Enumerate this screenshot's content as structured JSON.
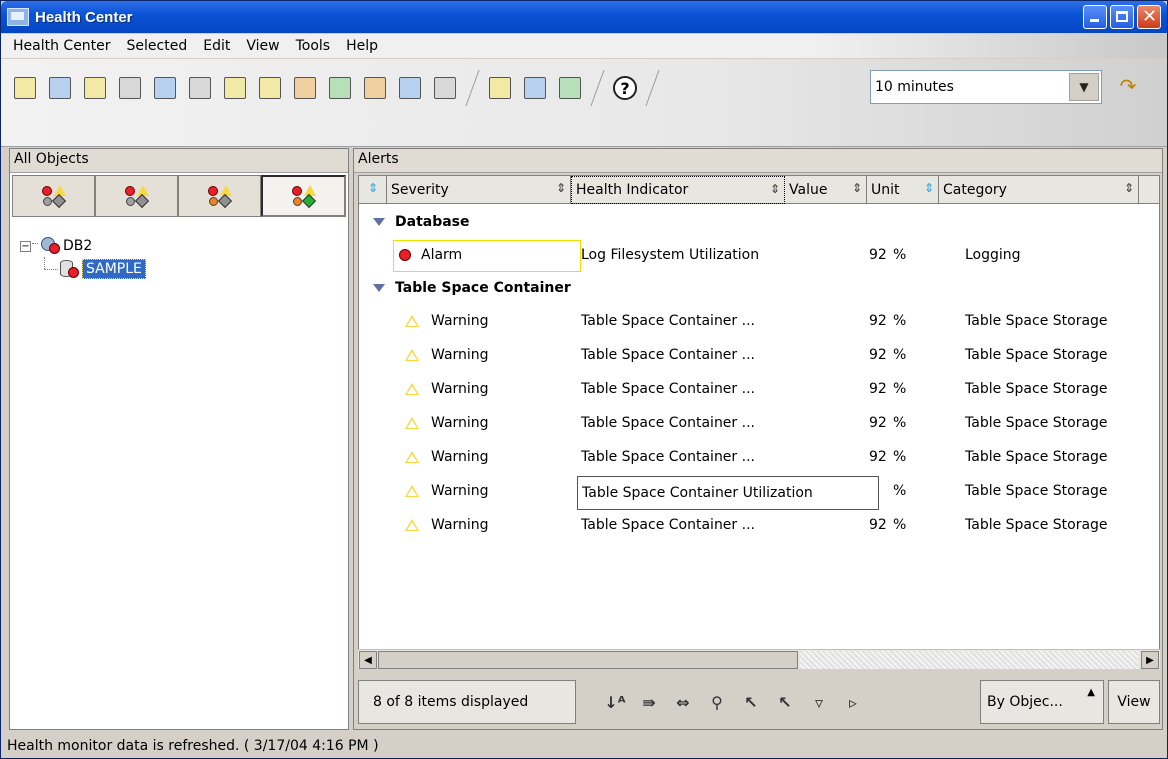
{
  "window": {
    "title": "Health Center"
  },
  "menu": [
    "Health Center",
    "Selected",
    "Edit",
    "View",
    "Tools",
    "Help"
  ],
  "toolbar": {
    "icons": [
      "object-tree-icon",
      "objects-icon",
      "hierarchy-icon",
      "database-icon",
      "command-icon",
      "script-icon",
      "journal-icon",
      "notes-icon",
      "license-icon",
      "health-icon",
      "replication-icon",
      "satellite-icon",
      "storage-icon",
      "task-icon",
      "console-icon",
      "list-icon"
    ],
    "refresh_interval": "10 minutes",
    "help_label": "?"
  },
  "left_panel": {
    "title": "All Objects",
    "filters": [
      {
        "name": "filter-alarm",
        "active": false
      },
      {
        "name": "filter-warning",
        "active": false
      },
      {
        "name": "filter-attention",
        "active": false
      },
      {
        "name": "filter-all",
        "active": true
      }
    ],
    "tree": {
      "root_label": "DB2",
      "child_label": "SAMPLE"
    }
  },
  "alerts_panel": {
    "title": "Alerts",
    "columns": [
      "Severity",
      "Health Indicator",
      "Value",
      "Unit",
      "Category"
    ],
    "groups": [
      {
        "label": "Database",
        "rows": [
          {
            "severity": "Alarm",
            "indicator": "Log Filesystem Utilization",
            "value": "92",
            "unit": "%",
            "category": "Logging"
          }
        ]
      },
      {
        "label": "Table Space Container",
        "rows": [
          {
            "severity": "Warning",
            "indicator": "Table Space Container ...",
            "value": "92",
            "unit": "%",
            "category": "Table Space Storage"
          },
          {
            "severity": "Warning",
            "indicator": "Table Space Container ...",
            "value": "92",
            "unit": "%",
            "category": "Table Space Storage"
          },
          {
            "severity": "Warning",
            "indicator": "Table Space Container ...",
            "value": "92",
            "unit": "%",
            "category": "Table Space Storage"
          },
          {
            "severity": "Warning",
            "indicator": "Table Space Container ...",
            "value": "92",
            "unit": "%",
            "category": "Table Space Storage"
          },
          {
            "severity": "Warning",
            "indicator": "Table Space Container ...",
            "value": "92",
            "unit": "%",
            "category": "Table Space Storage"
          },
          {
            "severity": "Warning",
            "indicator": "",
            "value": "",
            "unit": "%",
            "category": "Table Space Storage"
          },
          {
            "severity": "Warning",
            "indicator": "Table Space Container ...",
            "value": "92",
            "unit": "%",
            "category": "Table Space Storage"
          }
        ]
      }
    ],
    "tooltip": "Table Space Container Utilization",
    "items_count": "8 of 8 items displayed",
    "group_by": "By Objec...",
    "view_label": "View"
  },
  "status": {
    "message": "Health monitor data is refreshed. ( 3/17/04 4:16 PM )"
  }
}
